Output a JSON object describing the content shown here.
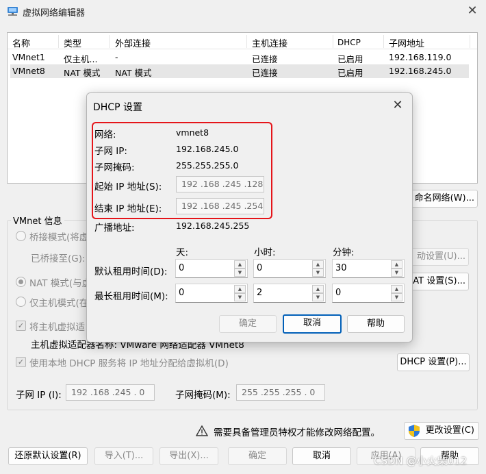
{
  "window": {
    "title": "虚拟网络编辑器",
    "close_symbol": "✕"
  },
  "table": {
    "headers": [
      "名称",
      "类型",
      "外部连接",
      "主机连接",
      "DHCP",
      "子网地址"
    ],
    "rows": [
      [
        "VMnet1",
        "仅主机...",
        "-",
        "已连接",
        "已启用",
        "192.168.119.0"
      ],
      [
        "VMnet8",
        "NAT 模式",
        "NAT 模式",
        "已连接",
        "已启用",
        "192.168.245.0"
      ]
    ],
    "selected_row": 1
  },
  "right_buttons": {
    "rename": "命名网络(W)...",
    "auto_settings": "动设置(U)...",
    "nat_settings": "AT 设置(S)..."
  },
  "vmnet_info": {
    "title": "VMnet 信息",
    "bridge_mode": "桥接模式(将虚",
    "bridged_to": "已桥接至(G):",
    "nat_mode": "NAT 模式(与虚",
    "host_only": "仅主机模式(在",
    "connect_adapter": "将主机虚拟适",
    "adapter_name": "主机虚拟适配器名称: VMware 网络适配器 VMnet8",
    "use_dhcp": "使用本地 DHCP 服务将 IP 地址分配给虚拟机(D)",
    "dhcp_settings_button": "DHCP 设置(P)...",
    "subnet_ip_label": "子网 IP (I):",
    "subnet_ip_value": "192 .168 .245 .  0",
    "subnet_mask_label": "子网掩码(M):",
    "subnet_mask_value": "255 .255 .255 .  0"
  },
  "footer": {
    "admin_notice": "需要具备管理员特权才能修改网络配置。",
    "change_settings": "更改设置(C)",
    "restore_defaults": "还原默认设置(R)",
    "import": "导入(T)...",
    "export": "导出(X)...",
    "ok": "确定",
    "cancel": "取消",
    "apply": "应用(A)",
    "help": "帮助"
  },
  "dialog": {
    "title": "DHCP 设置",
    "network_label": "网络:",
    "network_value": "vmnet8",
    "subnet_ip_label": "子网 IP:",
    "subnet_ip_value": "192.168.245.0",
    "subnet_mask_label": "子网掩码:",
    "subnet_mask_value": "255.255.255.0",
    "start_ip_label": "起始 IP 地址(S):",
    "start_ip_value": "192 .168 .245 .128",
    "end_ip_label": "结束 IP 地址(E):",
    "end_ip_value": "192 .168 .245 .254",
    "broadcast_label": "广播地址:",
    "broadcast_value": "192.168.245.255",
    "col_days": "天:",
    "col_hours": "小时:",
    "col_minutes": "分钟:",
    "default_lease_label": "默认租用时间(D):",
    "default_lease": [
      "0",
      "0",
      "30"
    ],
    "max_lease_label": "最长租用时间(M):",
    "max_lease": [
      "0",
      "2",
      "0"
    ],
    "ok": "确定",
    "cancel": "取消",
    "help": "帮助"
  },
  "watermark": "CSDN @小火柴012",
  "colors": {
    "highlight": "#e5151a",
    "focus": "#005fb8"
  }
}
